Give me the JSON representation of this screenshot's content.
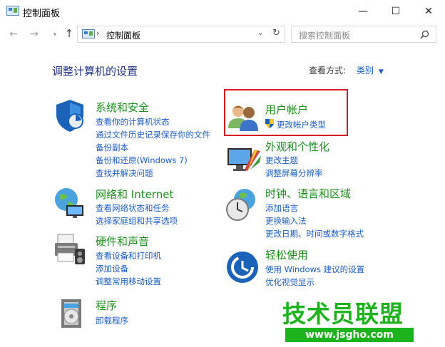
{
  "window": {
    "title": "控制面板"
  },
  "address": {
    "path": "控制面板",
    "search_placeholder": "搜索控制面板"
  },
  "main": {
    "heading": "调整计算机的设置",
    "view_by_label": "查看方式:",
    "view_by_value": "类别"
  },
  "categories": {
    "system": {
      "title": "系统和安全",
      "links": [
        "查看你的计算机状态",
        "通过文件历史记录保存你的文件",
        "备份副本",
        "备份和还原(Windows 7)",
        "查找并解决问题"
      ]
    },
    "network": {
      "title": "网络和 Internet",
      "links": [
        "查看网络状态和任务",
        "选择家庭组和共享选项"
      ]
    },
    "hardware": {
      "title": "硬件和声音",
      "links": [
        "查看设备和打印机",
        "添加设备",
        "调整常用移动设置"
      ]
    },
    "programs": {
      "title": "程序",
      "links": [
        "卸载程序"
      ]
    },
    "user": {
      "title": "用户帐户",
      "links": [
        "更改帐户类型"
      ]
    },
    "appearance": {
      "title": "外观和个性化",
      "links": [
        "更改主题",
        "调整屏幕分辨率"
      ]
    },
    "clock": {
      "title": "时钟、语言和区域",
      "links": [
        "添加语言",
        "更换输入法",
        "更改日期、时间或数字格式"
      ]
    },
    "ease": {
      "title": "轻松使用",
      "links": [
        "使用 Windows 建议的设置",
        "优化视觉显示"
      ]
    }
  },
  "watermark": {
    "name": "技术员联盟",
    "url": "www.jsgho.com"
  },
  "colors": {
    "title_green": "#1a8f1a",
    "link_blue": "#1a5dc8",
    "highlight_red": "#d21e1e"
  }
}
